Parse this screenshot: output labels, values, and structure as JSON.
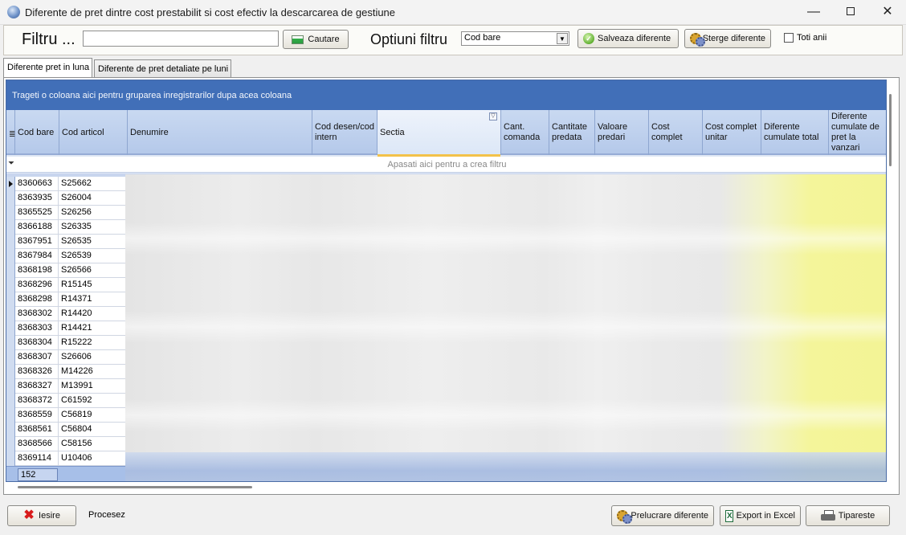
{
  "window": {
    "title": "Diferente de pret dintre cost prestabilit si cost efectiv la descarcarea de gestiune",
    "minimize": "—",
    "close": "✕"
  },
  "toolbar": {
    "filter_label": "Filtru ...",
    "filter_value": "",
    "search_button": "Cautare",
    "options_label": "Optiuni filtru",
    "options_selected": "Cod bare",
    "save_button": "Salveaza diferente",
    "delete_button": "Sterge diferente",
    "all_years_label": "Toti anii",
    "all_years_checked": false
  },
  "tabs": [
    {
      "label": "Diferente pret in luna",
      "active": true
    },
    {
      "label": "Diferente de pret detaliate pe luni",
      "active": false
    }
  ],
  "grid": {
    "group_panel_text": "Trageti o coloana aici pentru gruparea inregistrarilor dupa acea coloana",
    "filter_row_text": "Apasati aici pentru a  crea filtru",
    "columns": [
      "Cod bare",
      "Cod articol",
      "Denumire",
      "Cod desen/cod intern",
      "Sectia",
      "Cant. comanda",
      "Cantitate predata",
      "Valoare predari",
      "Cost complet",
      "Cost complet unitar",
      "Diferente cumulate total",
      "Diferente cumulate de pret la vanzari"
    ],
    "rows": [
      {
        "cod_bare": "8360663",
        "cod_articol": "S25662"
      },
      {
        "cod_bare": "8363935",
        "cod_articol": "S26004"
      },
      {
        "cod_bare": "8365525",
        "cod_articol": "S26256"
      },
      {
        "cod_bare": "8366188",
        "cod_articol": "S26335"
      },
      {
        "cod_bare": "8367951",
        "cod_articol": "S26535"
      },
      {
        "cod_bare": "8367984",
        "cod_articol": "S26539"
      },
      {
        "cod_bare": "8368198",
        "cod_articol": "S26566"
      },
      {
        "cod_bare": "8368296",
        "cod_articol": "R15145"
      },
      {
        "cod_bare": "8368298",
        "cod_articol": "R14371"
      },
      {
        "cod_bare": "8368302",
        "cod_articol": "R14420"
      },
      {
        "cod_bare": "8368303",
        "cod_articol": "R14421"
      },
      {
        "cod_bare": "8368304",
        "cod_articol": "R15222"
      },
      {
        "cod_bare": "8368307",
        "cod_articol": "S26606"
      },
      {
        "cod_bare": "8368326",
        "cod_articol": "M14226"
      },
      {
        "cod_bare": "8368327",
        "cod_articol": "M13991"
      },
      {
        "cod_bare": "8368372",
        "cod_articol": "C61592"
      },
      {
        "cod_bare": "8368559",
        "cod_articol": "C56819"
      },
      {
        "cod_bare": "8368561",
        "cod_articol": "C56804"
      },
      {
        "cod_bare": "8368566",
        "cod_articol": "C58156"
      },
      {
        "cod_bare": "8369114",
        "cod_articol": "U10406"
      }
    ],
    "record_count": "152"
  },
  "bottom": {
    "exit_button": "Iesire",
    "status_text": "Procesez",
    "process_button": "Prelucrare diferente",
    "export_button": "Export in Excel",
    "print_button": "Tipareste"
  },
  "colors": {
    "group_panel": "#416fb8",
    "header": "#c9d9f1",
    "highlight_yellow": "#f3f495"
  },
  "icons": {
    "app": "app-globe-icon",
    "search": "search-green-icon",
    "save": "check-circle-icon",
    "delete": "gears-icon",
    "exit": "red-x-icon",
    "process": "gears-icon",
    "export": "excel-icon",
    "print": "printer-icon"
  }
}
